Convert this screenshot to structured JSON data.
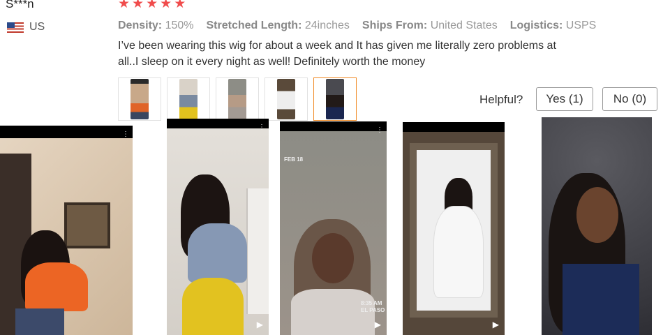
{
  "review": {
    "reviewer": "S***n",
    "country": "US",
    "rating": 5,
    "attributes": [
      {
        "key": "Density:",
        "value": "150%"
      },
      {
        "key": "Stretched Length:",
        "value": "24inches"
      },
      {
        "key": "Ships From:",
        "value": "United States"
      },
      {
        "key": "Logistics:",
        "value": "USPS"
      }
    ],
    "text": "I’ve been wearing this wig for about a week and It has given me literally zero problems at all..I sleep on it every night as well! Definitely worth the money",
    "helpful_label": "Helpful?",
    "yes_label": "Yes (1)",
    "no_label": "No (0)"
  },
  "photos": {
    "stamp_date": "FEB 18",
    "stamp_time": "8:35 AM",
    "stamp_place": "EL PASO"
  },
  "colors": {
    "star": "#f04c4c",
    "selected_border": "#f08a24"
  }
}
